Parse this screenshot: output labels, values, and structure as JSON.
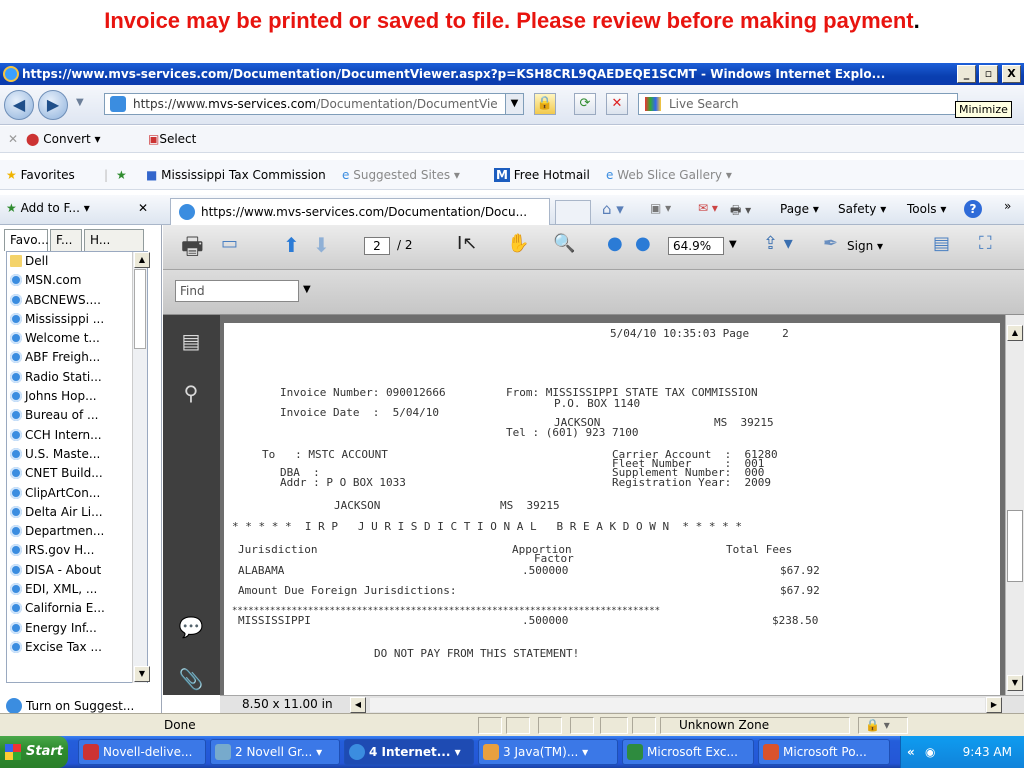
{
  "banner": {
    "text": "Invoice may be printed or saved to file. Please review before making payment",
    "dot": "."
  },
  "window": {
    "title": "https://www.mvs-services.com/Documentation/DocumentViewer.aspx?p=KSH8CRL9QAEDEQE1SCMT - Windows Internet Explo...",
    "minimize": "_",
    "maximize": "▫",
    "close": "X"
  },
  "address_bar": {
    "prefix": "https://www.",
    "domain": "mvs-services.com",
    "rest": "/Documentation/DocumentVie"
  },
  "search": {
    "placeholder": "Live Search"
  },
  "tooltip": "Minimize",
  "command_bar": {
    "convert": "Convert",
    "select": "Select"
  },
  "favorites_bar": {
    "favorites": "Favorites",
    "items": [
      "Mississippi Tax Commission",
      "Suggested Sites ▾",
      "Free Hotmail",
      "Web Slice Gallery ▾"
    ]
  },
  "tab_row": {
    "add_to": "Add to F...",
    "tab_title": "https://www.mvs-services.com/Documentation/Docu...",
    "tools": [
      "Page ▾",
      "Safety ▾",
      "Tools ▾"
    ]
  },
  "left_pane": {
    "tabs": [
      "Favo...",
      "F...",
      "H..."
    ],
    "items": [
      "Dell",
      "MSN.com",
      "ABCNEWS....",
      "Mississippi ...",
      "Welcome t...",
      "ABF Freigh...",
      "Radio Stati...",
      "Johns Hop...",
      "Bureau of ...",
      "CCH Intern...",
      "U.S. Maste...",
      "CNET Build...",
      "ClipArtCon...",
      "Delta Air Li...",
      "Departmen...",
      "IRS.gov H...",
      "DISA - About",
      "EDI, XML, ...",
      "California E...",
      "Energy Inf...",
      "Excise Tax ..."
    ],
    "turn_on": "Turn on Suggest..."
  },
  "pdf_toolbar": {
    "page_current": "2",
    "page_total": "/ 2",
    "zoom": "64.9%",
    "sign": "Sign ▾"
  },
  "find": {
    "placeholder": "Find"
  },
  "document": {
    "header": "5/04/10 10:35:03 Page     2",
    "invoice_number": "Invoice Number: 090012666",
    "from": "From: MISSISSIPPI STATE TAX COMMISSION",
    "po_box": "P.O. BOX 1140",
    "invoice_date": "Invoice Date  :  5/04/10",
    "jackson": "JACKSON",
    "ms_zip": "MS  39215",
    "tel": "Tel : (601) 923 7100",
    "to": "To   : MSTC ACCOUNT",
    "carrier_account": "Carrier Account  :  61280",
    "fleet_number": "Fleet Number     :  001",
    "dba": "DBA  :",
    "supplement_number": "Supplement Number:  000",
    "addr": "Addr : P O BOX 1033",
    "registration_year": "Registration Year:  2009",
    "addr_city": "JACKSON",
    "addr_state": "MS  39215",
    "breakdown_title": "* * * * *  I R P   J U R I S D I C T I O N A L   B R E A K D O W N  * * * * *",
    "col_jurisdiction": "Jurisdiction",
    "col_apportion": "Apportion",
    "col_factor": "Factor",
    "col_total": "Total Fees",
    "row1": {
      "jurisdiction": "ALABAMA",
      "factor": ".500000",
      "fee": "$67.92"
    },
    "amount_due_label": "Amount Due Foreign Jurisdictions:",
    "amount_due": "$67.92",
    "stars": "*******************************************************************************",
    "row2": {
      "jurisdiction": "MISSISSIPPI",
      "factor": ".500000",
      "fee": "$238.50"
    },
    "do_not_pay": "DO NOT PAY FROM THIS STATEMENT!"
  },
  "page_size": "8.50 x 11.00 in",
  "status": {
    "text": "Done",
    "zone": "Unknown Zone"
  },
  "taskbar": {
    "start": "Start",
    "tasks": [
      "Novell-delive...",
      "2 Novell Gr... ▾",
      "4 Internet... ▾",
      "3 Java(TM)... ▾",
      "Microsoft Exc...",
      "Microsoft Po..."
    ],
    "clock": "9:43 AM"
  }
}
